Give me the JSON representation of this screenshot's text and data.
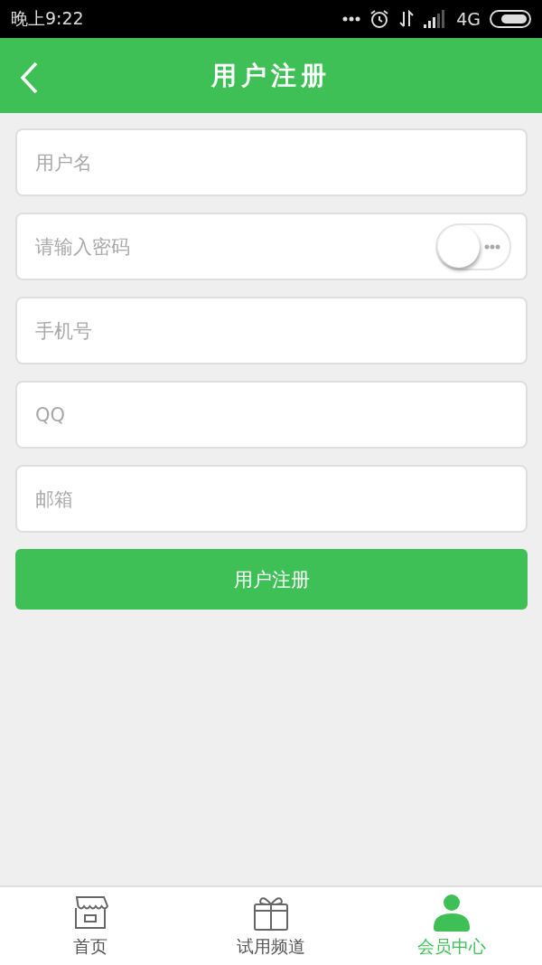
{
  "status_bar": {
    "time": "晚上9:22",
    "network": "4G"
  },
  "header": {
    "title": "用户注册"
  },
  "fields": [
    {
      "placeholder": "用户名",
      "kind": "text"
    },
    {
      "placeholder": "请输入密码",
      "kind": "password",
      "show_password": false
    },
    {
      "placeholder": "手机号",
      "kind": "text"
    },
    {
      "placeholder": "QQ",
      "kind": "text"
    },
    {
      "placeholder": "邮箱",
      "kind": "text"
    }
  ],
  "submit_button": "用户注册",
  "tabs": [
    {
      "label": "首页",
      "kind": "store",
      "selected": false
    },
    {
      "label": "试用频道",
      "kind": "gift",
      "selected": false
    },
    {
      "label": "会员中心",
      "kind": "user",
      "selected": true
    }
  ]
}
